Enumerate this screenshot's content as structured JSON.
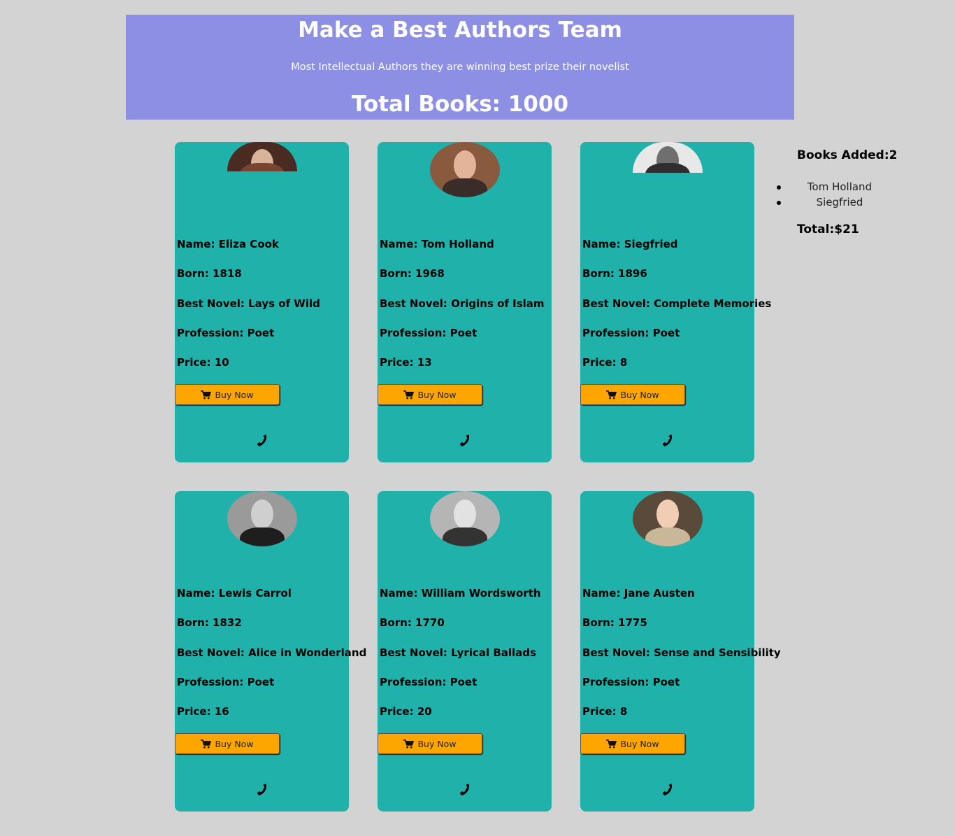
{
  "header": {
    "title": "Make a Best Authors Team",
    "subtitle": "Most Intellectual Authors they are winning best prize their novelist",
    "total_books": "Total Books: 1000"
  },
  "buy_label": "Buy Now",
  "icons": {
    "buy": "cart-icon",
    "contact": "phone-icon"
  },
  "colors": {
    "header_bg": "#8c8fe3",
    "card_bg": "#20b2aa",
    "button_bg": "#ffa500",
    "page_bg": "#d3d3d3"
  },
  "authors": [
    {
      "name": "Name: Eliza Cook",
      "born": "Born: 1818",
      "novel": "Best Novel: Lays of Wild",
      "profession": "Profession: Poet",
      "price": "Price: 10"
    },
    {
      "name": "Name: Tom Holland",
      "born": "Born: 1968",
      "novel": "Best Novel: Origins of Islam",
      "profession": "Profession: Poet",
      "price": "Price: 13"
    },
    {
      "name": "Name: Siegfried",
      "born": "Born: 1896",
      "novel": "Best Novel: Complete Memories",
      "profession": "Profession: Poet",
      "price": "Price: 8"
    },
    {
      "name": "Name: Lewis Carrol",
      "born": "Born: 1832",
      "novel": "Best Novel: Alice in Wonderland",
      "profession": "Profession: Poet",
      "price": "Price: 16"
    },
    {
      "name": "Name: William Wordsworth",
      "born": "Born: 1770",
      "novel": "Best Novel: Lyrical Ballads",
      "profession": "Profession: Poet",
      "price": "Price: 20"
    },
    {
      "name": "Name: Jane Austen",
      "born": "Born: 1775",
      "novel": "Best Novel: Sense and Sensibility",
      "profession": "Profession: Poet",
      "price": "Price: 8"
    }
  ],
  "cart": {
    "title": "Books Added:2",
    "items": [
      "Tom Holland",
      "Siegfried"
    ],
    "total": "Total:$21"
  }
}
